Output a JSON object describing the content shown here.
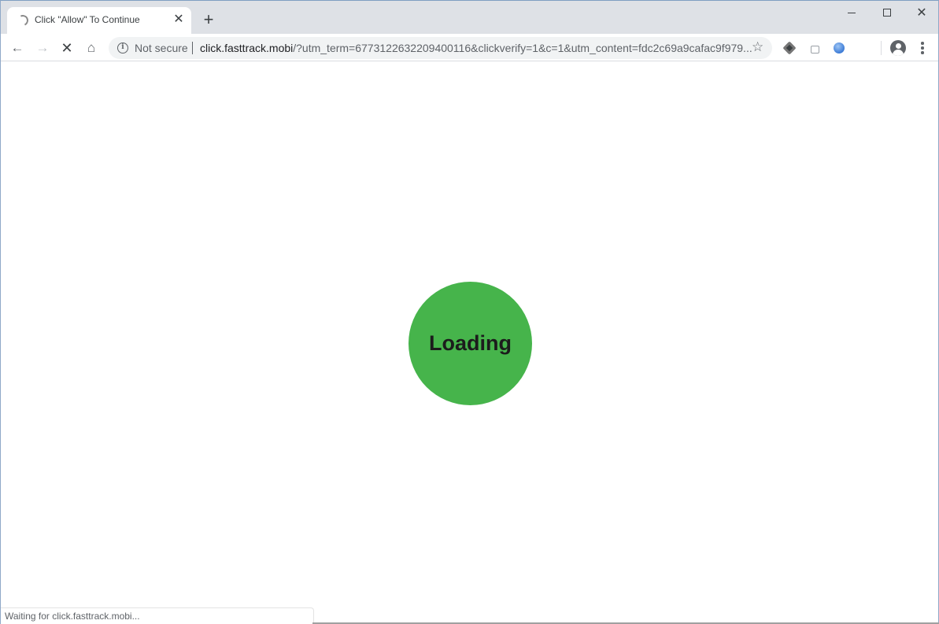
{
  "browser": {
    "tab": {
      "title": "Click \"Allow\" To Continue",
      "loading": true,
      "close_glyph": "✕"
    },
    "new_tab_glyph": "+",
    "window_controls": {
      "minimize": "minimize",
      "maximize": "maximize",
      "close_glyph": "✕"
    },
    "toolbar": {
      "back_glyph": "←",
      "forward_glyph": "→",
      "stop_glyph": "✕",
      "home_glyph": "⌂",
      "security_label": "Not secure",
      "info_glyph": "i",
      "url_host": "click.fasttrack.mobi",
      "url_rest": "/?utm_term=6773122632209400116&clickverify=1&c=1&utm_content=fdc2c69a9cafac9f979...",
      "star_glyph": "☆",
      "extensions": [
        "extension-diamond-icon",
        "extension-box-icon",
        "extension-globe-icon"
      ],
      "profile": "account-avatar-icon",
      "menu": "more-vert-icon"
    },
    "status_text": "Waiting for click.fasttrack.mobi..."
  },
  "page": {
    "loader_label": "Loading",
    "accent_color": "#46b44b"
  }
}
